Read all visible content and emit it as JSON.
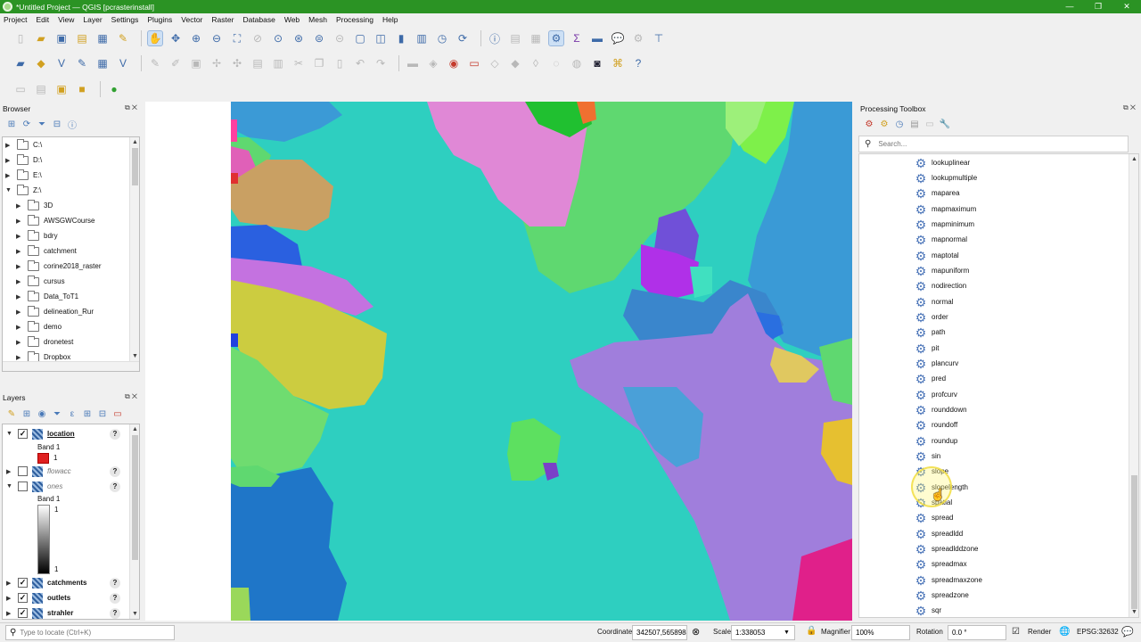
{
  "window": {
    "title": "*Untitled Project — QGIS [pcrasterinstall]",
    "controls": [
      "—",
      "❐",
      "✕"
    ]
  },
  "menubar": [
    "Project",
    "Edit",
    "View",
    "Layer",
    "Settings",
    "Plugins",
    "Vector",
    "Raster",
    "Database",
    "Web",
    "Mesh",
    "Processing",
    "Help"
  ],
  "browser": {
    "title": "Browser",
    "panel_buttons": "⧉ ✕",
    "items": [
      {
        "label": "C:\\",
        "level": 0,
        "expanded": false
      },
      {
        "label": "D:\\",
        "level": 0,
        "expanded": false
      },
      {
        "label": "E:\\",
        "level": 0,
        "expanded": false
      },
      {
        "label": "Z:\\",
        "level": 0,
        "expanded": true
      },
      {
        "label": "3D",
        "level": 1,
        "expanded": false
      },
      {
        "label": "AWSGWCourse",
        "level": 1,
        "expanded": false
      },
      {
        "label": "bdry",
        "level": 1,
        "expanded": false
      },
      {
        "label": "catchment",
        "level": 1,
        "expanded": false
      },
      {
        "label": "corine2018_raster",
        "level": 1,
        "expanded": false
      },
      {
        "label": "cursus",
        "level": 1,
        "expanded": false
      },
      {
        "label": "Data_ToT1",
        "level": 1,
        "expanded": false
      },
      {
        "label": "delineation_Rur",
        "level": 1,
        "expanded": false
      },
      {
        "label": "demo",
        "level": 1,
        "expanded": false
      },
      {
        "label": "dronetest",
        "level": 1,
        "expanded": false
      },
      {
        "label": "Dropbox",
        "level": 1,
        "expanded": false
      }
    ]
  },
  "layers": {
    "title": "Layers",
    "panel_buttons": "⧉ ✕",
    "location": {
      "name": "location",
      "checked": true,
      "band": "Band 1",
      "class_value": "1",
      "class_color": "#e02020"
    },
    "flowacc": {
      "name": "flowacc",
      "checked": false
    },
    "ones": {
      "name": "ones",
      "checked": false,
      "band": "Band 1",
      "max": "1",
      "min": "1"
    },
    "catchments": {
      "name": "catchments",
      "checked": true
    },
    "outlets": {
      "name": "outlets",
      "checked": true
    },
    "strahler": {
      "name": "strahler",
      "checked": true
    },
    "help": "?"
  },
  "toolbox": {
    "title": "Processing Toolbox",
    "panel_buttons": "⧉ ✕",
    "search_placeholder": "Search...",
    "algorithms": [
      "lookuplinear",
      "lookupmultiple",
      "maparea",
      "mapmaximum",
      "mapminimum",
      "mapnormal",
      "maptotal",
      "mapuniform",
      "nodirection",
      "normal",
      "order",
      "path",
      "pit",
      "plancurv",
      "pred",
      "profcurv",
      "rounddown",
      "roundoff",
      "roundup",
      "sin",
      "slope",
      "slopelength",
      "spatial",
      "spread",
      "spreadldd",
      "spreadlddzone",
      "spreadmax",
      "spreadmaxzone",
      "spreadzone",
      "sqr"
    ],
    "hovered": "slopelength"
  },
  "statusbar": {
    "locate_placeholder": "Type to locate (Ctrl+K)",
    "coordinate_label": "Coordinate",
    "coordinate_value": "342507,5658984",
    "scale_label": "Scale",
    "scale_value": "1:338053",
    "magnifier_label": "Magnifier",
    "magnifier_value": "100%",
    "rotation_label": "Rotation",
    "rotation_value": "0.0 °",
    "render_label": "Render",
    "crs": "EPSG:32632"
  },
  "colors": {
    "titlebar": "#2b9324",
    "map_main": "#2ecfc0",
    "selection": "#cde0f5"
  }
}
